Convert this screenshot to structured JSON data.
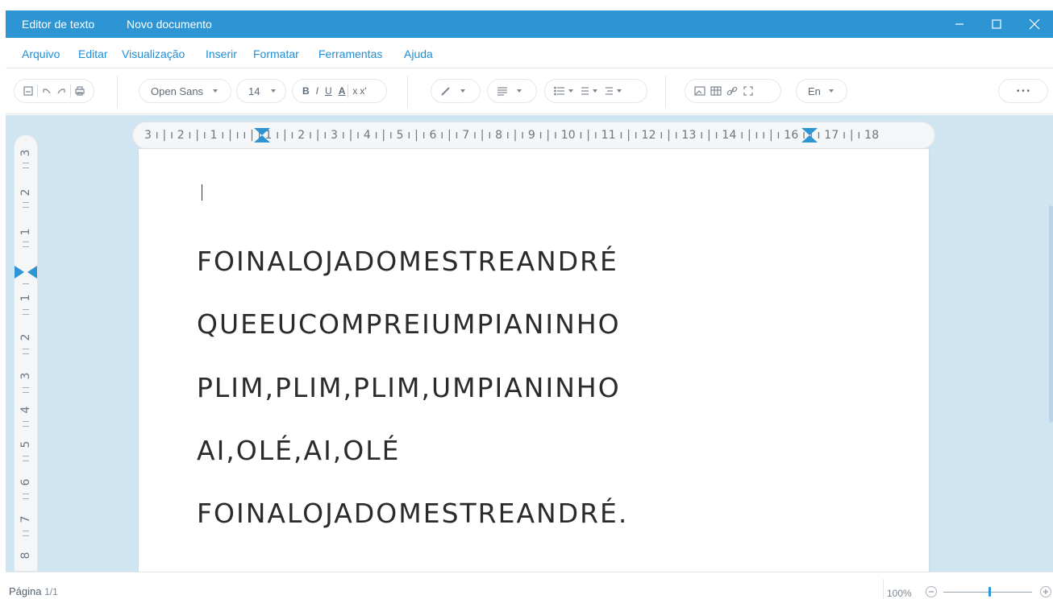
{
  "titlebar": {
    "app_name": "Editor de texto",
    "doc_name": "Novo documento",
    "minimize_icon": "minimize-icon",
    "maximize_icon": "maximize-icon",
    "close_icon": "close-icon"
  },
  "menu": {
    "items": [
      "Arquivo",
      "Editar",
      "Visualização",
      "Inserir",
      "Formatar",
      "Ferramentas",
      "Ajuda"
    ]
  },
  "toolbar": {
    "font_family": "Open Sans",
    "font_size": "14",
    "bold": "B",
    "italic": "I",
    "underline": "U",
    "font_color": "A",
    "subscript": "x",
    "superscript": "x'",
    "language": "En",
    "more": "• • •"
  },
  "ruler": {
    "horizontal": "3 ı | ı 2 ı | ı 1 ı | ı     ı | ı 1 ı | ı 2 ı | ı 3 ı | ı 4 ı | ı 5 ı | ı 6 ı | ı 7 ı | ı 8 ı | ı 9 ı | ı 10 ı | ı 11 ı | ı 12 ı | ı 13 ı | ı 14 ı | ı     ı | ı 16 ı | ı 17 ı | ı 18",
    "vertical_top": [
      "3",
      "2",
      "1"
    ],
    "vertical_bottom": [
      "1",
      "2",
      "3",
      "4",
      "5",
      "6",
      "7",
      "8"
    ]
  },
  "document": {
    "lines": [
      "FOINALOJADOMESTREANDRÉ",
      "QUEEUCOMPREIUMPIANINHO",
      "PLIM,PLIM,PLIM,UMPIANINHO",
      "AI,OLÉ,AI,OLÉ",
      "FOINALOJADOMESTREANDRÉ."
    ]
  },
  "status": {
    "page_label": "Página",
    "page_count": "1/1",
    "zoom": "100%",
    "zoom_level_fraction": 0.5
  },
  "colors": {
    "accent": "#2d95d3",
    "workspace": "#d0e5f2",
    "menu_text": "#1f8dd6"
  }
}
